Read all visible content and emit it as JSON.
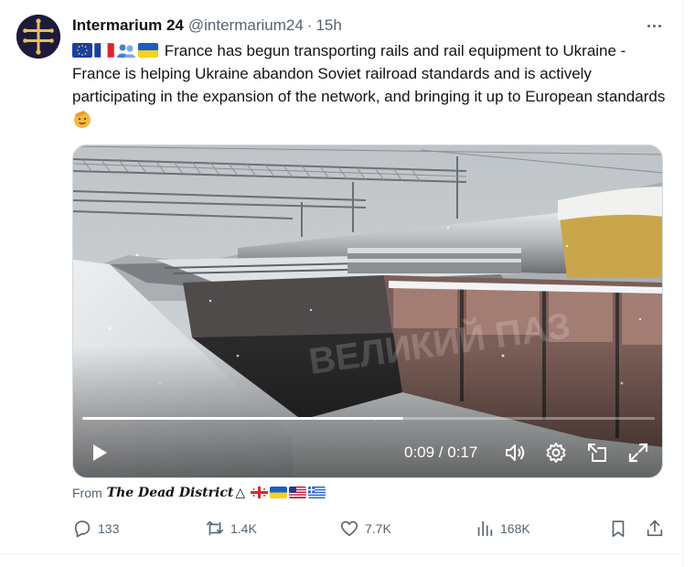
{
  "author": {
    "display_name": "Intermarium 24",
    "handle": "@intermarium24",
    "separator": "·",
    "time": "15h"
  },
  "tweet": {
    "text": "France has begun transporting rails and rail equipment to Ukraine - France is helping Ukraine abandon Soviet railroad standards and is actively participating in the expansion of the network, and bringing it up to European standards",
    "leading_emoji": [
      "eu-flag",
      "france-flag",
      "handshake",
      "ukraine-flag"
    ],
    "trailing_emoji": "saluting-face"
  },
  "video": {
    "timecode": "0:09 / 0:17",
    "progress": 0.56,
    "watermark": "ВЕЛИКИЙ ПАЗ"
  },
  "source": {
    "prefix": "From",
    "name": "The Dead District",
    "symbol": "△",
    "flags": [
      "georgia-flag",
      "ukraine-flag",
      "usa-flag",
      "greece-flag"
    ]
  },
  "actions": {
    "replies": "133",
    "reposts": "1.4K",
    "likes": "7.7K",
    "views": "168K"
  },
  "colors": {
    "text_primary": "#0f1419",
    "text_secondary": "#536471",
    "border": "#cfd9de"
  }
}
